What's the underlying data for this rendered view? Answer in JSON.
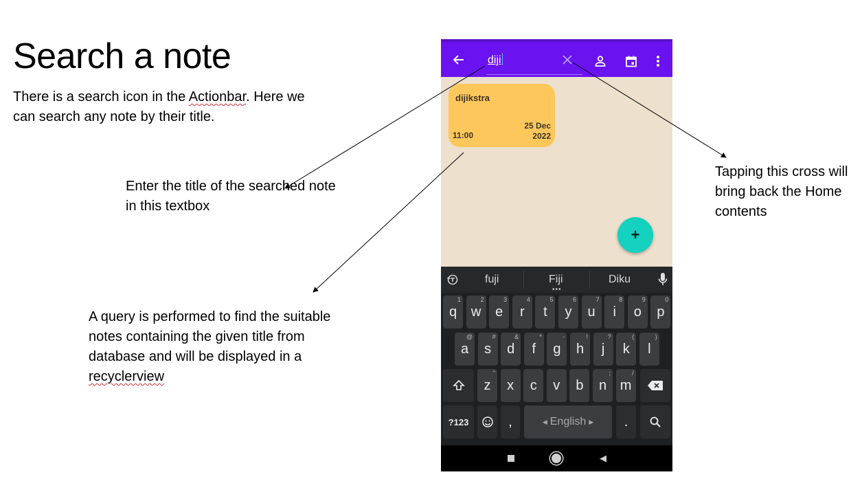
{
  "slide": {
    "title": "Search a note",
    "intro_part1": "There is a search icon in the ",
    "intro_link": "Actionbar",
    "intro_part2": ". Here we can search any note by their title.",
    "textbox_note": "Enter the title of the searched note in this textbox",
    "query_note_main": "A query is performed to find the suitable notes containing the given title from database and will be displayed in a ",
    "query_note_link": "recyclerview",
    "cross_note": "Tapping this cross will bring back the Home contents"
  },
  "app": {
    "actionbar": {
      "search_value": "diji",
      "icons": [
        "back-arrow-icon",
        "clear-icon",
        "person-icon",
        "calendar-icon",
        "more-vert-icon"
      ]
    },
    "note": {
      "title": "dijikstra",
      "date_day": "25 Dec",
      "date_year": "2022",
      "time": "11:00"
    },
    "fab_label": "+"
  },
  "keyboard": {
    "suggestions": [
      "fuji",
      "Fiji",
      "Diku"
    ],
    "row1": [
      [
        "q",
        "1"
      ],
      [
        "w",
        "2"
      ],
      [
        "e",
        "3"
      ],
      [
        "r",
        "4"
      ],
      [
        "t",
        "5"
      ],
      [
        "y",
        "6"
      ],
      [
        "u",
        "7"
      ],
      [
        "i",
        "8"
      ],
      [
        "o",
        "9"
      ],
      [
        "p",
        "0"
      ]
    ],
    "row2": [
      [
        "a",
        "@"
      ],
      [
        "s",
        "#"
      ],
      [
        "d",
        "&"
      ],
      [
        "f",
        "*"
      ],
      [
        "g",
        "-"
      ],
      [
        "h",
        "!"
      ],
      [
        "j",
        "?"
      ],
      [
        "k",
        "("
      ],
      [
        "l",
        ")"
      ]
    ],
    "row3": [
      [
        "z",
        "\""
      ],
      [
        "x",
        ""
      ],
      [
        "c",
        ""
      ],
      [
        "v",
        ""
      ],
      [
        "b",
        ""
      ],
      [
        "n",
        ";"
      ],
      [
        "m",
        "/"
      ]
    ],
    "symbols_key": "?123",
    "comma_key": ",",
    "space_label": "English",
    "period_key": ".",
    "colors": {
      "background": "#1f2021",
      "key": "#3c3d3f",
      "text": "#ececec"
    }
  },
  "colors": {
    "actionbar": "#6a12f0",
    "note_card": "#fec75c",
    "fab": "#14d1c0",
    "app_background": "#ede0cc"
  }
}
